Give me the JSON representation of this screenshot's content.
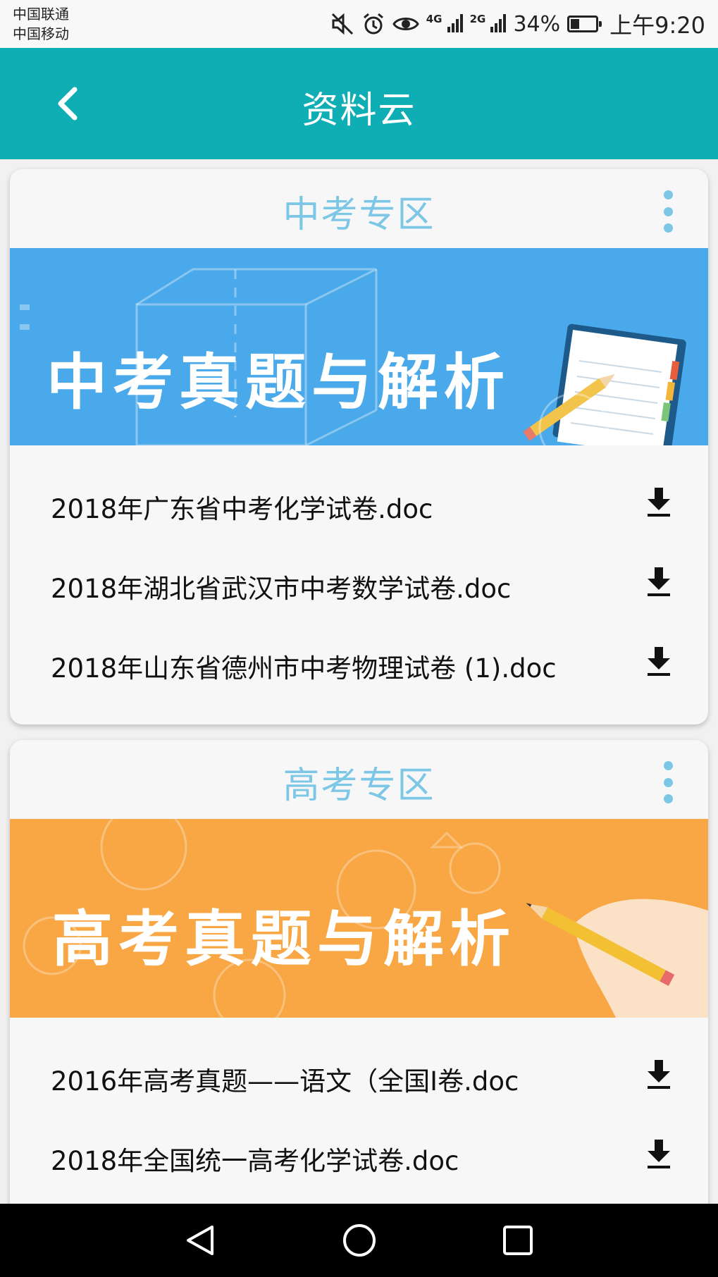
{
  "status_bar": {
    "carrier1": "中国联通",
    "carrier2": "中国移动",
    "net1": "4G",
    "net2": "2G",
    "battery_level": 0.34,
    "battery_text": "34%",
    "time": "上午9:20"
  },
  "app_bar": {
    "title": "资料云"
  },
  "sections": [
    {
      "title": "中考专区",
      "banner_text": "中考真题与解析",
      "files": [
        "2018年广东省中考化学试卷.doc",
        "2018年湖北省武汉市中考数学试卷.doc",
        "2018年山东省德州市中考物理试卷 (1).doc"
      ]
    },
    {
      "title": "高考专区",
      "banner_text": "高考真题与解析",
      "files": [
        "2016年高考真题——语文（全国I卷.doc",
        "2018年全国统一高考化学试卷.doc"
      ]
    }
  ],
  "colors": {
    "app_bar": "#0fadb4",
    "section_title": "#7cc6e6",
    "banner_blue": "#4aa9ea",
    "banner_orange": "#f8a744"
  }
}
